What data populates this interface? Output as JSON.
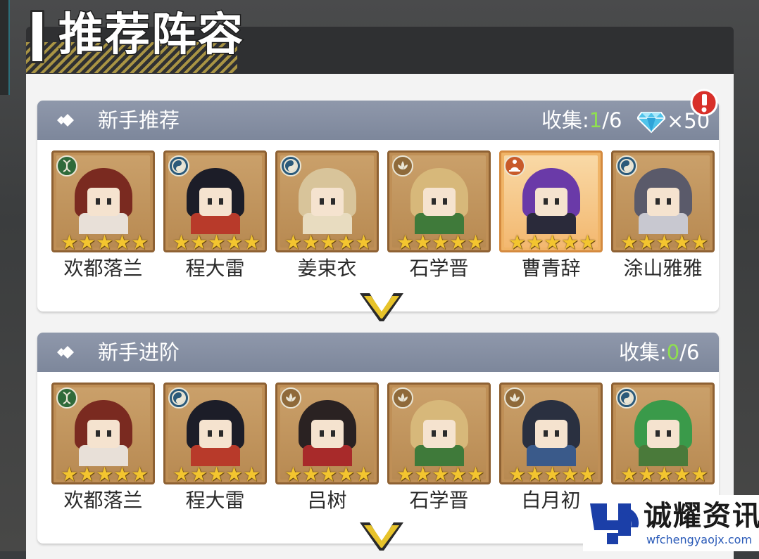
{
  "page": {
    "title": "推荐阵容"
  },
  "sections": [
    {
      "title": "新手推荐",
      "collect_label": "收集:",
      "collect_current": "1",
      "collect_total": "/6",
      "reward": "×50",
      "reward_icon": "diamond-icon",
      "has_alert": true,
      "heroes": [
        {
          "name": "欢都落兰",
          "stars": 5,
          "type_icon": "dna-icon",
          "hair": "#7a2a20",
          "cloth": "#e8e0d8",
          "gold": false
        },
        {
          "name": "程大雷",
          "stars": 5,
          "type_icon": "swirl-icon",
          "hair": "#1c1d28",
          "cloth": "#b83a2a",
          "gold": false
        },
        {
          "name": "姜束衣",
          "stars": 5,
          "type_icon": "swirl-icon",
          "hair": "#d8c49a",
          "cloth": "#e8dcc0",
          "gold": false
        },
        {
          "name": "石学晋",
          "stars": 5,
          "type_icon": "lotus-icon",
          "hair": "#d7b87a",
          "cloth": "#3f7a3a",
          "gold": false
        },
        {
          "name": "曹青辞",
          "stars": 5,
          "type_icon": "meditate-icon",
          "hair": "#6a3aa8",
          "cloth": "#2a2a3a",
          "gold": true
        },
        {
          "name": "涂山雅雅",
          "stars": 5,
          "type_icon": "swirl-icon",
          "hair": "#5a5a6a",
          "cloth": "#c8c8d0",
          "gold": false
        }
      ]
    },
    {
      "title": "新手进阶",
      "collect_label": "收集:",
      "collect_current": "0",
      "collect_total": "/6",
      "heroes": [
        {
          "name": "欢都落兰",
          "stars": 5,
          "type_icon": "dna-icon",
          "hair": "#7a2a20",
          "cloth": "#e8e0d8",
          "gold": false
        },
        {
          "name": "程大雷",
          "stars": 5,
          "type_icon": "swirl-icon",
          "hair": "#1c1d28",
          "cloth": "#b83a2a",
          "gold": false
        },
        {
          "name": "吕树",
          "stars": 5,
          "type_icon": "lotus-icon",
          "hair": "#2a2222",
          "cloth": "#a82a2a",
          "gold": false
        },
        {
          "name": "石学晋",
          "stars": 5,
          "type_icon": "lotus-icon",
          "hair": "#d7b87a",
          "cloth": "#3f7a3a",
          "gold": false
        },
        {
          "name": "白月初",
          "stars": 5,
          "type_icon": "lotus-icon",
          "hair": "#2a3040",
          "cloth": "#3a5a8a",
          "gold": false
        },
        {
          "name": "",
          "stars": 5,
          "type_icon": "swirl-icon",
          "hair": "#3a9a4a",
          "cloth": "#4a7a3a",
          "gold": false
        }
      ]
    }
  ],
  "watermark": {
    "text": "诚耀资讯",
    "url": "wfchengyaojx.com"
  }
}
